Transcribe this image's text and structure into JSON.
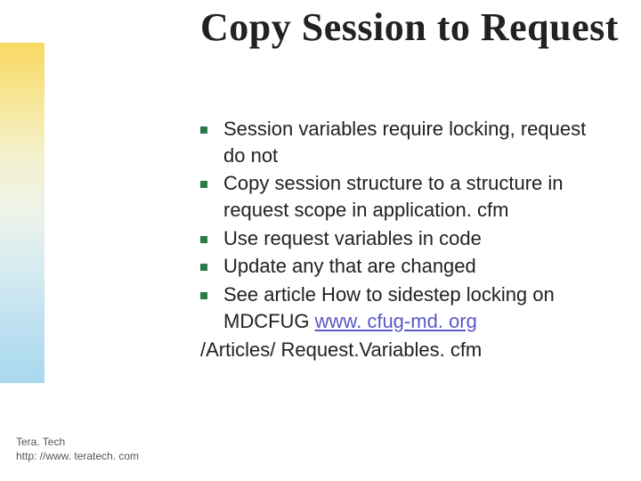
{
  "title": "Copy Session to Request",
  "bullets": [
    "Session variables require locking, request do not",
    "Copy session structure to a structure in request scope in application. cfm",
    "Use request variables in code",
    "Update any that are changed"
  ],
  "bullet5_prefix": "See article How to sidestep locking on MDCFUG ",
  "bullet5_link": "www. cfug-md. org",
  "trailing": "/Articles/ Request.Variables. cfm",
  "footer_line1": "Tera. Tech",
  "footer_line2": "http: //www. teratech. com"
}
